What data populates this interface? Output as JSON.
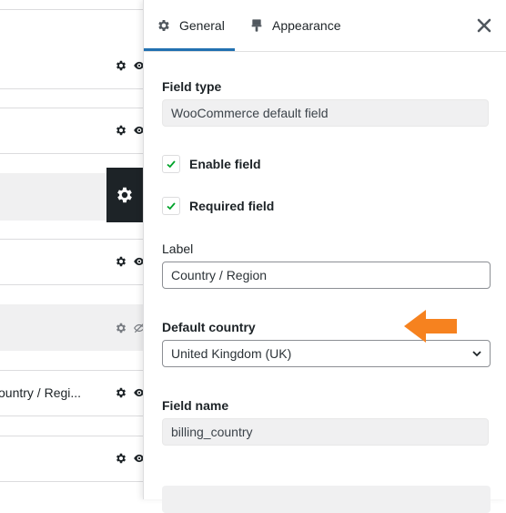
{
  "tabs": [
    {
      "label": "General",
      "icon": "gear-icon"
    },
    {
      "label": "Appearance",
      "icon": "paintbrush-icon"
    }
  ],
  "field_type": {
    "label": "Field type",
    "value": "WooCommerce default field"
  },
  "enable_field": {
    "label": "Enable field",
    "checked": true
  },
  "required_field": {
    "label": "Required field",
    "checked": true
  },
  "label_field": {
    "label": "Label",
    "value": "Country / Region"
  },
  "default_country": {
    "label": "Default country",
    "value": "United Kingdom (UK)"
  },
  "field_name": {
    "label": "Field name",
    "value": "billing_country"
  },
  "list": {
    "visible_row_label": "ountry / Regi..."
  },
  "colors": {
    "accent": "#2271b1",
    "check": "#00a32a",
    "arrow": "#f6821f",
    "active_gear_bg": "#1d2327"
  }
}
